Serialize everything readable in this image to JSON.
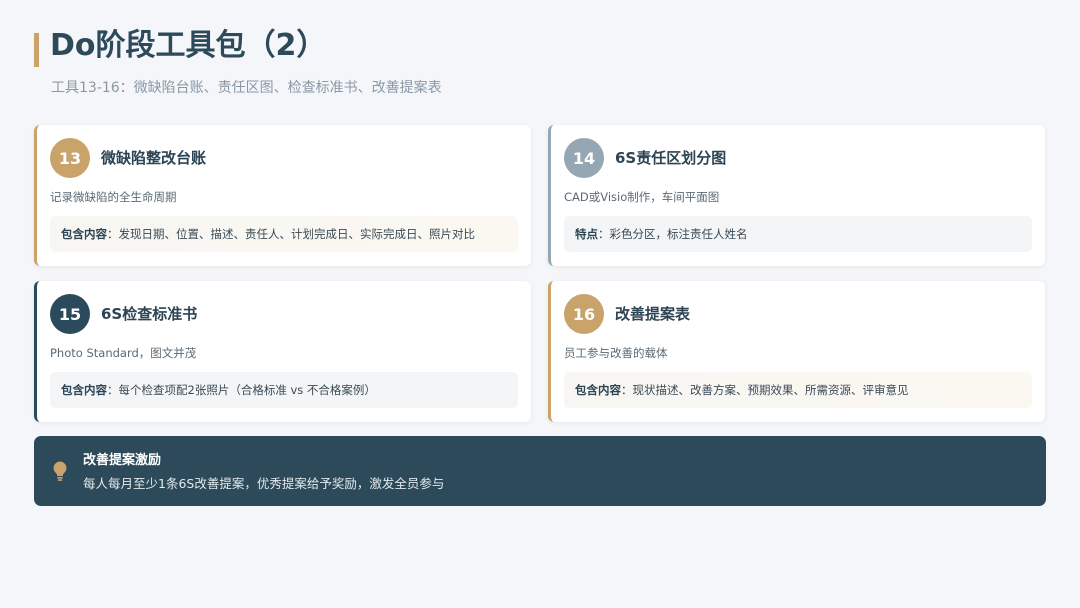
{
  "header": {
    "title": "Do阶段工具包（2）",
    "subtitle": "工具13-16：微缺陷台账、责任区图、检查标准书、改善提案表"
  },
  "cards": [
    {
      "number": "13",
      "title": "微缺陷整改台账",
      "description": "记录微缺陷的全生命周期",
      "box_label": "包含内容",
      "box_text": "：发现日期、位置、描述、责任人、计划完成日、实际完成日、照片对比"
    },
    {
      "number": "14",
      "title": "6S责任区划分图",
      "description": "CAD或Visio制作，车间平面图",
      "box_label": "特点",
      "box_text": "：彩色分区，标注责任人姓名"
    },
    {
      "number": "15",
      "title": "6S检查标准书",
      "description": "Photo Standard，图文并茂",
      "box_label": "包含内容",
      "box_text": "：每个检查项配2张照片（合格标准 vs 不合格案例）"
    },
    {
      "number": "16",
      "title": "改善提案表",
      "description": "员工参与改善的载体",
      "box_label": "包含内容",
      "box_text": "：现状描述、改善方案、预期效果、所需资源、评审意见"
    }
  ],
  "banner": {
    "icon": "lightbulb-icon",
    "title": "改善提案激励",
    "text": "每人每月至少1条6S改善提案，优秀提案给予奖励，激发全员参与"
  },
  "colors": {
    "gold": "#c9a36a",
    "gray": "#95a7b2",
    "navy": "#2b4a5b",
    "background": "#f4f6f9"
  }
}
